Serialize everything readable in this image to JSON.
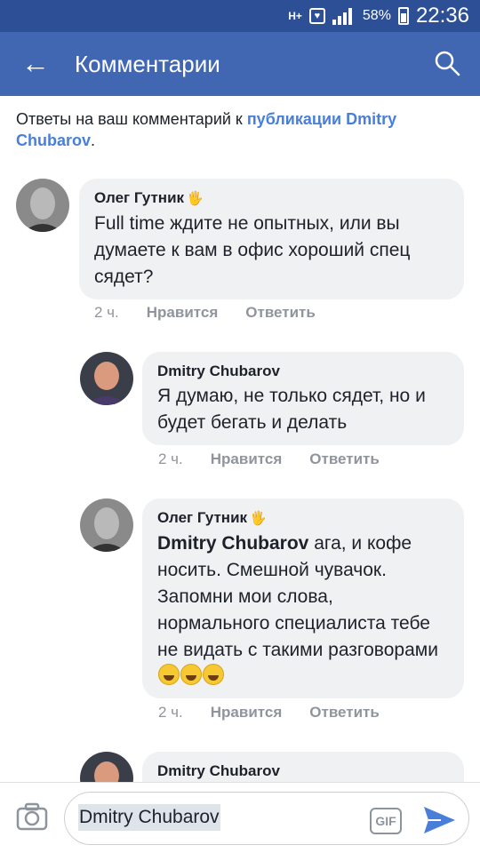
{
  "status_bar": {
    "network": "H+",
    "battery": "58%",
    "time": "22:36"
  },
  "app_bar": {
    "title": "Комментарии"
  },
  "header": {
    "prefix": "Ответы на ваш комментарий к ",
    "link": "публикации Dmitry Chubarov",
    "suffix": "."
  },
  "comments": [
    {
      "author": "Олег Гутник",
      "text": "Full time ждите не опытных, или вы думаете к вам в офис хороший спец сядет?",
      "time": "2 ч.",
      "like": "Нравится",
      "reply": "Ответить"
    },
    {
      "author": "Dmitry Chubarov",
      "text": "Я думаю, не только сядет, но и будет бегать и делать",
      "time": "2 ч.",
      "like": "Нравится",
      "reply": "Ответить"
    },
    {
      "author": "Олег Гутник",
      "mention": "Dmitry Chubarov",
      "text": " ага, и кофе носить. Смешной чувачок. Запомни мои слова, нормального специалиста тебе не видать с такими разговорами",
      "time": "2 ч.",
      "like": "Нравится",
      "reply": "Ответить"
    },
    {
      "author": "Dmitry Chubarov"
    }
  ],
  "composer": {
    "value": "Dmitry Chubarov",
    "gif_label": "GIF"
  },
  "colors": {
    "status_bar": "#2c4f95",
    "app_bar": "#4267b2",
    "link": "#4a7fd9",
    "bubble": "#f0f1f3",
    "meta": "#90949c"
  }
}
